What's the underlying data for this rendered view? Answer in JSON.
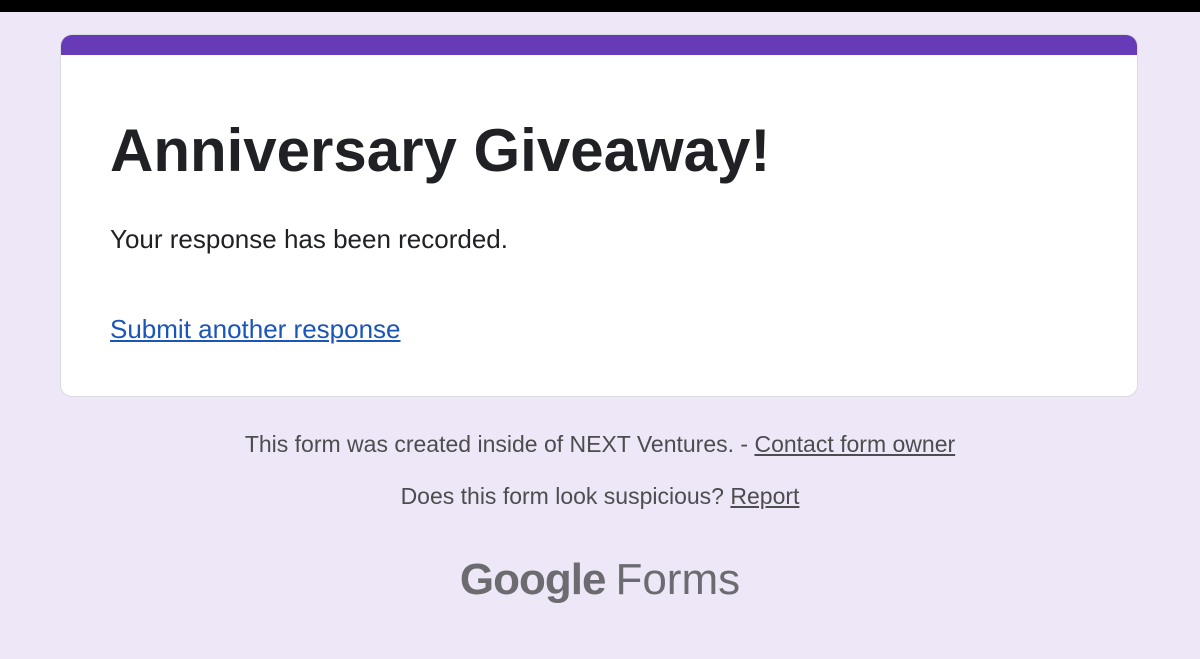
{
  "form": {
    "title": "Anniversary Giveaway!",
    "confirmation_message": "Your response has been recorded.",
    "submit_another_label": "Submit another response"
  },
  "footer": {
    "created_text": "This form was created inside of NEXT Ventures. - ",
    "contact_owner_label": "Contact form owner",
    "suspicious_text": "Does this form look suspicious? ",
    "report_label": "Report"
  },
  "branding": {
    "company": "Google",
    "product": "Forms"
  },
  "colors": {
    "accent": "#673ab7",
    "background": "#ede7f7",
    "link": "#1a55b8"
  }
}
